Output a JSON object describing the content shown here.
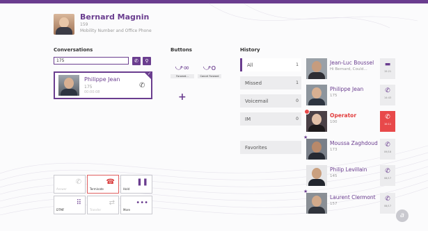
{
  "user": {
    "name": "Bernard Magnin",
    "extension": "159",
    "subtitle": "Mobility Number and Office Phone"
  },
  "sections": {
    "conversations": "Conversations",
    "buttons": "Buttons",
    "history": "History"
  },
  "search": {
    "value": "175"
  },
  "conversation": {
    "name": "Philippe Jean",
    "number": "175",
    "duration": "00:00:08"
  },
  "buttons": {
    "forward": "Forward...",
    "cancel_forward": "Cancel Forward"
  },
  "controls": {
    "answer": "Answer",
    "terminate": "Terminate",
    "hold": "Hold",
    "dtmf": "DTMF",
    "transfer": "Transfer",
    "more": "More"
  },
  "filters": [
    {
      "label": "All",
      "count": "1"
    },
    {
      "label": "Missed",
      "count": "1"
    },
    {
      "label": "Voicemail",
      "count": "0"
    },
    {
      "label": "IM",
      "count": "0"
    }
  ],
  "favorites": "Favorites",
  "history": [
    {
      "name": "Jean-Luc Boussel",
      "sub": "Hi Bernard, Could...",
      "time": "15:21",
      "icon": "message-icon"
    },
    {
      "name": "Philippe Jean",
      "sub": "175",
      "time": "14:43",
      "icon": "phone-icon"
    },
    {
      "name": "Operator",
      "sub": "100",
      "time": "10:11",
      "icon": "phone-missed-icon"
    },
    {
      "name": "Moussa Zaghdoud",
      "sub": "173",
      "time": "09/18",
      "icon": "phone-icon"
    },
    {
      "name": "Philip Levillain",
      "sub": "145",
      "time": "08/17",
      "icon": "phone-icon"
    },
    {
      "name": "Laurent Clermont",
      "sub": "157",
      "time": "08/17",
      "icon": "phone-icon"
    }
  ],
  "colors": {
    "accent": "#6a3d8f",
    "missed": "#e8494a",
    "tile_bg": "#ececee"
  }
}
